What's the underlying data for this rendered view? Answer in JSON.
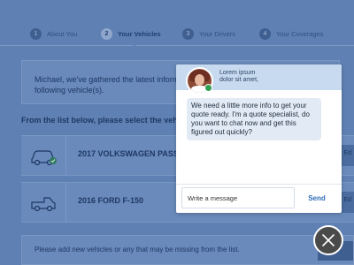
{
  "steps": [
    {
      "num": "1",
      "label": "About You"
    },
    {
      "num": "2",
      "label": "Your Vehicles"
    },
    {
      "num": "3",
      "label": "Your Drivers"
    },
    {
      "num": "4",
      "label": "Your Coverages"
    }
  ],
  "notice": {
    "text": "Michael, we've gathered the latest informa... following vehicle(s)."
  },
  "instruction": "From the list below, please select the vehic...",
  "vehicles": [
    {
      "name": "2017 VOLKSWAGEN PASS...",
      "side": "Ed"
    },
    {
      "name": "2016 FORD F-150",
      "side": "Ed"
    }
  ],
  "bottom_bar": {
    "text": "Please add new vehicles or any that may be missing from the list."
  },
  "chat": {
    "agent_line1": "Lorem ipsum",
    "agent_line2": "dolor sit amet,",
    "message": "We need a little more info to get your quote ready. I'm a quote specialist, do you want to chat now and get this figured out quickly?",
    "input_placeholder": "Write a message",
    "send_label": "Send"
  },
  "colors": {
    "overlay": "#5f80b3",
    "chat_header": "#c7daf0",
    "bubble": "#e2ebf5",
    "send": "#2e6bb8",
    "online": "#2e9e4f",
    "close_button": "#4a4a4a"
  },
  "icons": {
    "close": "close-icon",
    "car": "car-icon",
    "truck": "truck-icon",
    "check": "check-icon"
  }
}
